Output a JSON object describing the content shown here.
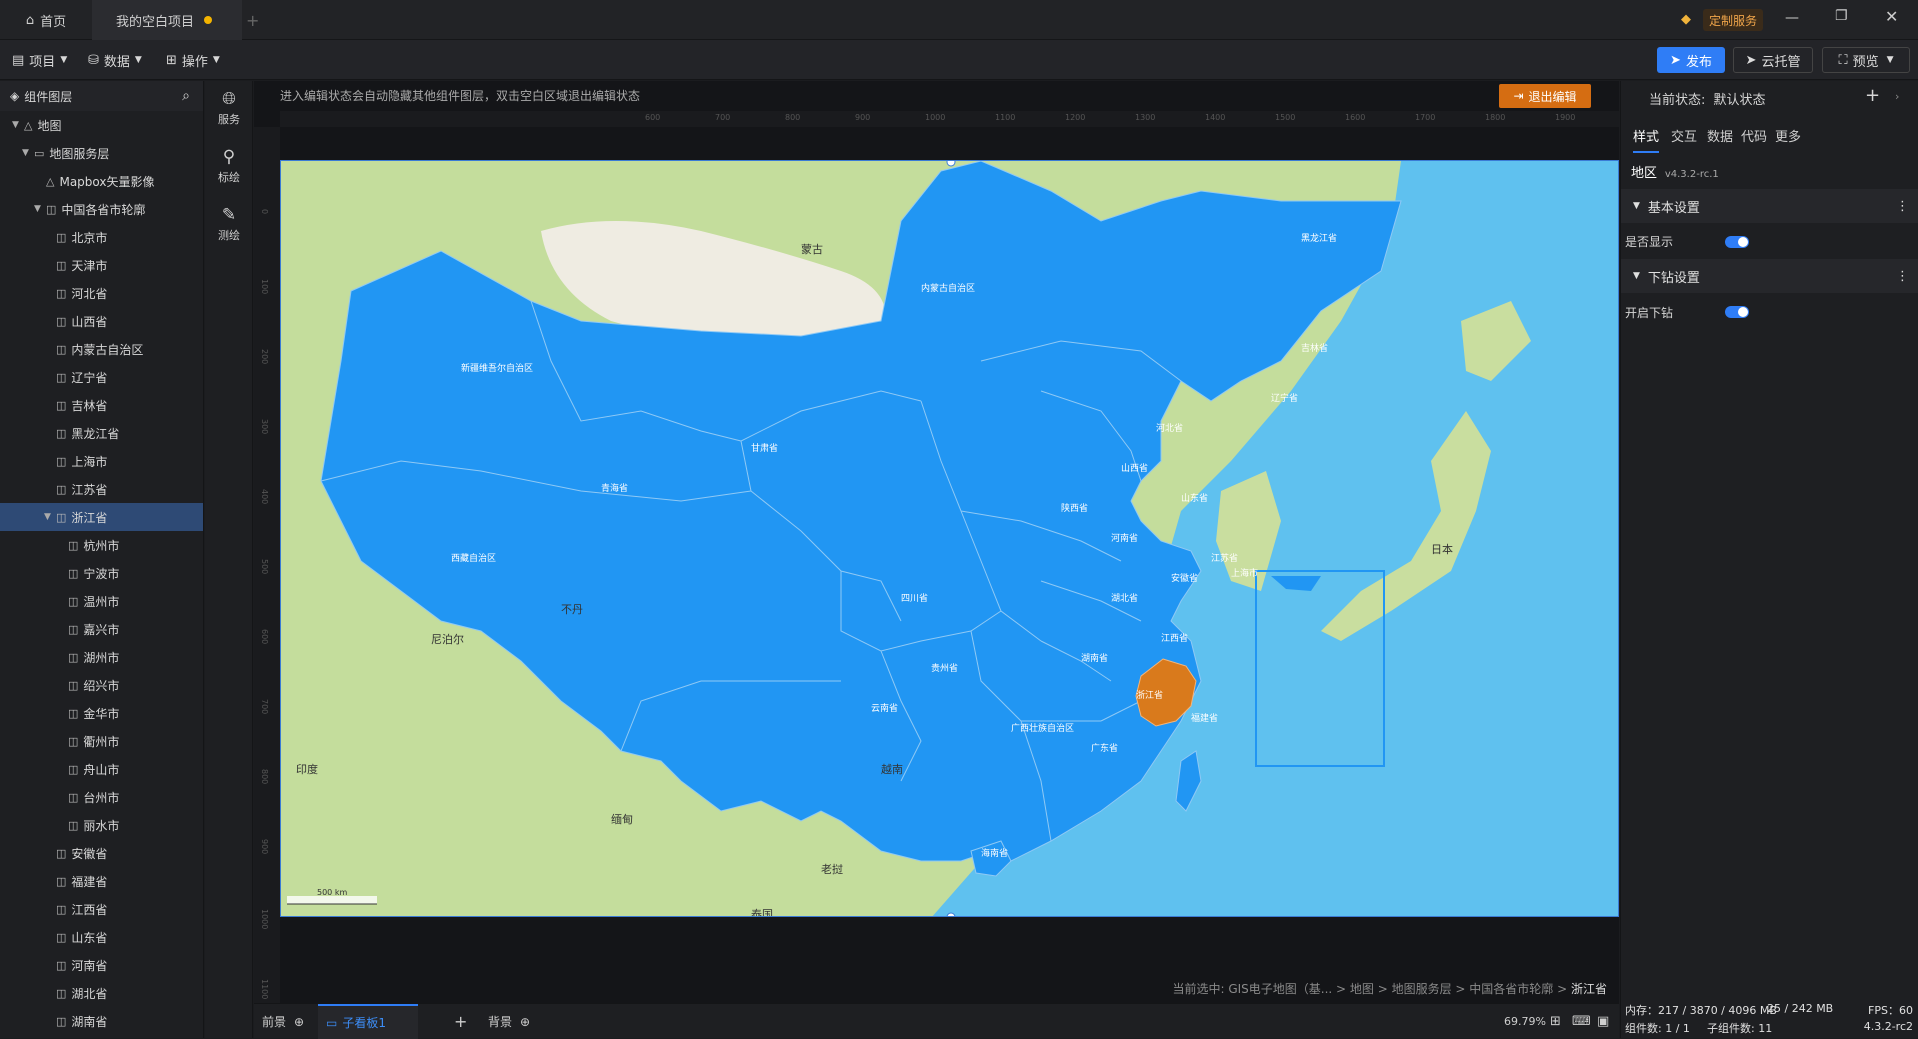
{
  "titlebar": {
    "home_tab": "首页",
    "project_tab": "我的空白项目",
    "custom_service": "定制服务"
  },
  "menubar": {
    "project": "项目",
    "data": "数据",
    "operate": "操作",
    "publish": "发布",
    "cloud_host": "云托管",
    "preview": "预览"
  },
  "layers": {
    "title": "组件图层",
    "items": [
      {
        "label": "地图",
        "level": 0,
        "icon": "△",
        "caret": "▼"
      },
      {
        "label": "地图服务层",
        "level": 1,
        "icon": "▭",
        "caret": "▼"
      },
      {
        "label": "Mapbox矢量影像",
        "level": 2,
        "icon": "△",
        "caret": ""
      },
      {
        "label": "中国各省市轮廓",
        "level": 2,
        "icon": "◫",
        "caret": "▼"
      },
      {
        "label": "北京市",
        "level": 3,
        "icon": "◫",
        "caret": ""
      },
      {
        "label": "天津市",
        "level": 3,
        "icon": "◫",
        "caret": ""
      },
      {
        "label": "河北省",
        "level": 3,
        "icon": "◫",
        "caret": ""
      },
      {
        "label": "山西省",
        "level": 3,
        "icon": "◫",
        "caret": ""
      },
      {
        "label": "内蒙古自治区",
        "level": 3,
        "icon": "◫",
        "caret": ""
      },
      {
        "label": "辽宁省",
        "level": 3,
        "icon": "◫",
        "caret": ""
      },
      {
        "label": "吉林省",
        "level": 3,
        "icon": "◫",
        "caret": ""
      },
      {
        "label": "黑龙江省",
        "level": 3,
        "icon": "◫",
        "caret": ""
      },
      {
        "label": "上海市",
        "level": 3,
        "icon": "◫",
        "caret": ""
      },
      {
        "label": "江苏省",
        "level": 3,
        "icon": "◫",
        "caret": ""
      },
      {
        "label": "浙江省",
        "level": 3,
        "icon": "◫",
        "caret": "▼",
        "selected": true
      },
      {
        "label": "杭州市",
        "level": 4,
        "icon": "◫",
        "caret": ""
      },
      {
        "label": "宁波市",
        "level": 4,
        "icon": "◫",
        "caret": ""
      },
      {
        "label": "温州市",
        "level": 4,
        "icon": "◫",
        "caret": ""
      },
      {
        "label": "嘉兴市",
        "level": 4,
        "icon": "◫",
        "caret": ""
      },
      {
        "label": "湖州市",
        "level": 4,
        "icon": "◫",
        "caret": ""
      },
      {
        "label": "绍兴市",
        "level": 4,
        "icon": "◫",
        "caret": ""
      },
      {
        "label": "金华市",
        "level": 4,
        "icon": "◫",
        "caret": ""
      },
      {
        "label": "衢州市",
        "level": 4,
        "icon": "◫",
        "caret": ""
      },
      {
        "label": "舟山市",
        "level": 4,
        "icon": "◫",
        "caret": ""
      },
      {
        "label": "台州市",
        "level": 4,
        "icon": "◫",
        "caret": ""
      },
      {
        "label": "丽水市",
        "level": 4,
        "icon": "◫",
        "caret": ""
      },
      {
        "label": "安徽省",
        "level": 3,
        "icon": "◫",
        "caret": ""
      },
      {
        "label": "福建省",
        "level": 3,
        "icon": "◫",
        "caret": ""
      },
      {
        "label": "江西省",
        "level": 3,
        "icon": "◫",
        "caret": ""
      },
      {
        "label": "山东省",
        "level": 3,
        "icon": "◫",
        "caret": ""
      },
      {
        "label": "河南省",
        "level": 3,
        "icon": "◫",
        "caret": ""
      },
      {
        "label": "湖北省",
        "level": 3,
        "icon": "◫",
        "caret": ""
      },
      {
        "label": "湖南省",
        "level": 3,
        "icon": "◫",
        "caret": ""
      }
    ]
  },
  "rail": {
    "service": "服务",
    "marker": "标绘",
    "measure": "测绘"
  },
  "canvas": {
    "hint": "进入编辑状态会自动隐藏其他组件图层，双击空白区域退出编辑状态",
    "exit_edit": "退出编辑",
    "breadcrumb_prefix": "当前选中: GIS电子地图（基... > 地图 > 地图服务层 > 中国各省市轮廓 > ",
    "breadcrumb_current": "浙江省",
    "scale": "500 km",
    "ruler_h": [
      "600",
      "700",
      "800",
      "900",
      "1000",
      "1100",
      "1200",
      "1300",
      "1400",
      "1500",
      "1600",
      "1700",
      "1800",
      "1900"
    ],
    "ruler_v": [
      "0",
      "100",
      "200",
      "300",
      "400",
      "500",
      "600",
      "700",
      "800",
      "900",
      "1000",
      "1100"
    ]
  },
  "map": {
    "provinces": [
      {
        "label": "新疆维吾尔自治区"
      },
      {
        "label": "西藏自治区"
      },
      {
        "label": "青海省"
      },
      {
        "label": "甘肃省"
      },
      {
        "label": "内蒙古自治区"
      },
      {
        "label": "黑龙江省"
      },
      {
        "label": "吉林省"
      },
      {
        "label": "辽宁省"
      },
      {
        "label": "河北省"
      },
      {
        "label": "山西省"
      },
      {
        "label": "山东省"
      },
      {
        "label": "陕西省"
      },
      {
        "label": "河南省"
      },
      {
        "label": "江苏省"
      },
      {
        "label": "安徽省"
      },
      {
        "label": "湖北省"
      },
      {
        "label": "四川省"
      },
      {
        "label": "贵州省"
      },
      {
        "label": "湖南省"
      },
      {
        "label": "江西省"
      },
      {
        "label": "云南省"
      },
      {
        "label": "福建省"
      },
      {
        "label": "广西壮族自治区"
      },
      {
        "label": "广东省"
      },
      {
        "label": "海南省"
      },
      {
        "label": "上海市"
      },
      {
        "label": "浙江省"
      }
    ],
    "foreign": [
      {
        "label": "蒙古"
      },
      {
        "label": "日本"
      },
      {
        "label": "印度"
      },
      {
        "label": "尼泊尔"
      },
      {
        "label": "缅甸"
      },
      {
        "label": "泰国"
      },
      {
        "label": "老挝"
      },
      {
        "label": "越南"
      },
      {
        "label": "不丹"
      }
    ],
    "colors": {
      "province": "#2196f3",
      "selected": "#d97a1c",
      "sea": "#5fc1ef",
      "land": "#c4dd9c"
    }
  },
  "bottombar": {
    "foreground": "前景",
    "child_board": "子看板1",
    "background": "背景",
    "zoom": "69.79%"
  },
  "rightpanel": {
    "state_label": "当前状态:",
    "state_value": "默认状态",
    "tabs": [
      "样式",
      "交互",
      "数据",
      "代码",
      "更多"
    ],
    "component_name": "地区",
    "version": "v4.3.2-rc.1",
    "basic_settings": "基本设置",
    "show_label": "是否显示",
    "drill_settings": "下钻设置",
    "drill_label": "开启下钻",
    "memory": "内存：217 / 3870 / 4096 MB",
    "mem2": "25 / 242 MB",
    "fps": "FPS：60",
    "components": "组件数: 1 / 1",
    "subcomponents": "子组件数: 11",
    "build": "4.3.2-rc2"
  }
}
